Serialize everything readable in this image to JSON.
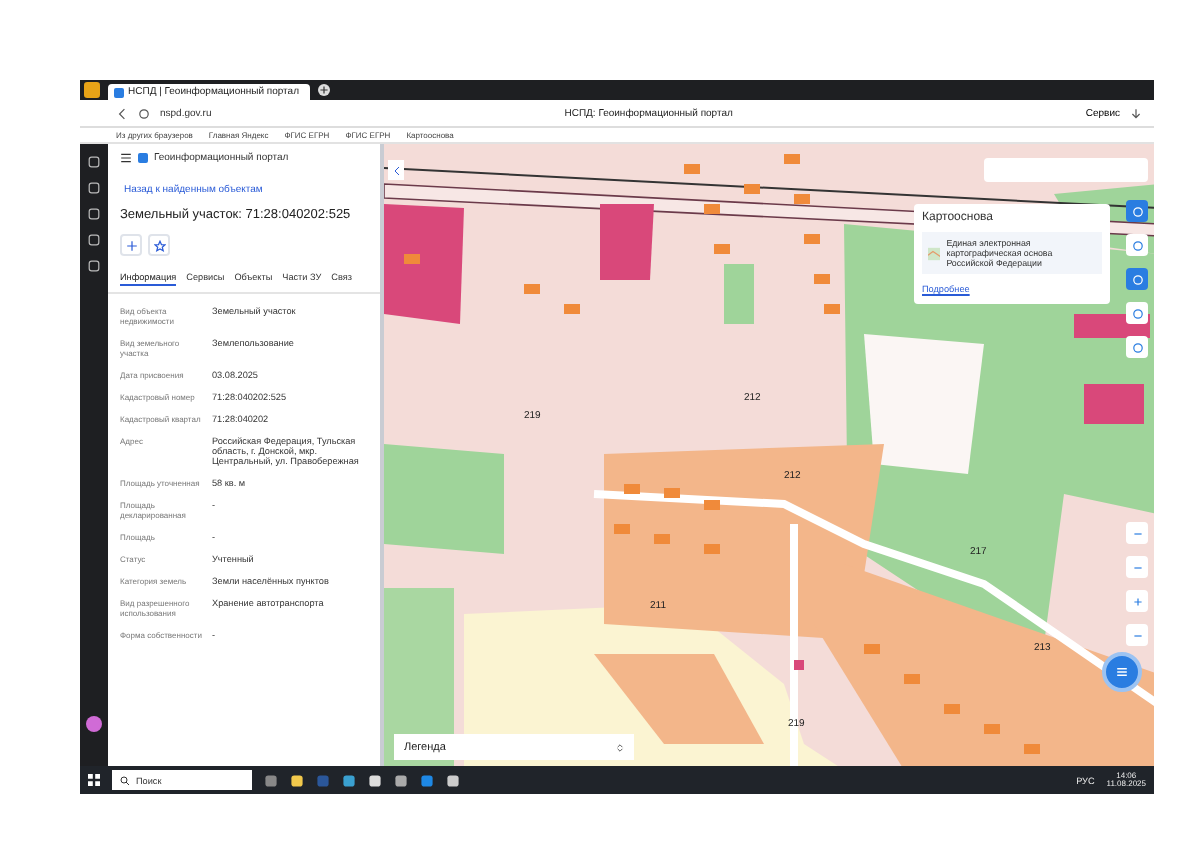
{
  "browser": {
    "tab_title": "НСПД | Геоинформационный портал",
    "address": "nspd.gov.ru",
    "page_title": "НСПД: Геоинформационный портал",
    "service_label": "Сервис",
    "bookmarks": [
      "Из других браузеров",
      "Главная Яндекс",
      "ФГИС ЕГРН",
      "ФГИС ЕГРН",
      "Картооснова"
    ]
  },
  "panel": {
    "portal_title": "Геоинформационный портал",
    "back_link": "Назад к найденным объектам",
    "object_title": "Земельный участок: 71:28:040202:525",
    "tabs": [
      {
        "label": "Информация",
        "selected": true
      },
      {
        "label": "Сервисы",
        "selected": false
      },
      {
        "label": "Объекты",
        "selected": false
      },
      {
        "label": "Части ЗУ",
        "selected": false
      },
      {
        "label": "Связ",
        "selected": false
      }
    ],
    "rows": [
      {
        "label": "Вид объекта недвижимости",
        "value": "Земельный участок"
      },
      {
        "label": "Вид земельного участка",
        "value": "Землепользование"
      },
      {
        "label": "Дата присвоения",
        "value": "03.08.2025"
      },
      {
        "label": "Кадастровый номер",
        "value": "71:28:040202:525"
      },
      {
        "label": "Кадастровый квартал",
        "value": "71:28:040202"
      },
      {
        "label": "Адрес",
        "value": "Российская Федерация, Тульская область, г. Донской, мкр. Центральный, ул. Правобережная"
      },
      {
        "label": "Площадь уточненная",
        "value": "58 кв. м"
      },
      {
        "label": "Площадь декларированная",
        "value": "-"
      },
      {
        "label": "Площадь",
        "value": "-"
      },
      {
        "label": "Статус",
        "value": "Учтенный"
      },
      {
        "label": "Категория земель",
        "value": "Земли населённых пунктов"
      },
      {
        "label": "Вид разрешенного использования",
        "value": "Хранение автотранспорта"
      },
      {
        "label": "Форма собственности",
        "value": "-"
      }
    ]
  },
  "map": {
    "basemap_card": {
      "title": "Картооснова",
      "description": "Единая электронная картографическая основа Российской Федерации",
      "link": "Подробнее"
    },
    "legend": "Легенда",
    "labels": [
      {
        "text": "219"
      },
      {
        "text": "212"
      },
      {
        "text": "212"
      },
      {
        "text": "217"
      },
      {
        "text": "211"
      },
      {
        "text": "219"
      },
      {
        "text": "213"
      }
    ]
  },
  "taskbar": {
    "search": "Поиск",
    "language": "РУС",
    "time": "14:06",
    "date": "11.08.2025"
  }
}
